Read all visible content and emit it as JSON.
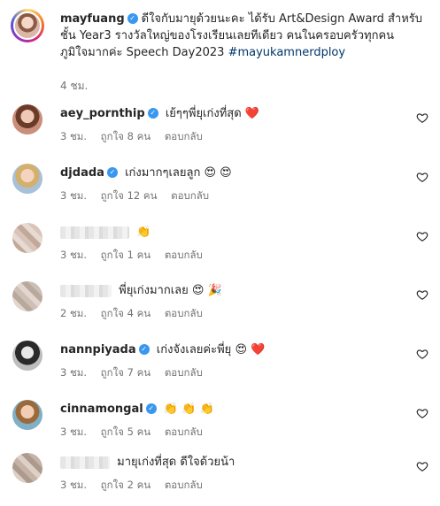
{
  "caption": {
    "username": "mayfuang",
    "text_line1": "ดีใจกับมายุด้วยนะคะ ได้รับ Art&Design Award สำหรับ",
    "text_line2": "ชั้น Year3 รางวัลใหญ่ของโรงเรียนเลยทีเดียว คนในครอบครัวทุกคน",
    "text_line3": "ภูมิใจมากค่ะ Speech Day2023",
    "hashtag": "#mayukamnerdploy",
    "time": "4 ชม."
  },
  "labels": {
    "likes_prefix": "ถูกใจ",
    "likes_suffix": "คน",
    "reply": "ตอบกลับ"
  },
  "comments": [
    {
      "username": "aey_pornthip",
      "verified": true,
      "text": "เย้ๆๆพี่ยุเก่งที่สุด",
      "emoji": "❤️",
      "time": "3 ชม.",
      "likes": "8"
    },
    {
      "username": "djdada",
      "verified": true,
      "text": "เก่งมากๆเลยลูก",
      "emoji": "😍 😍",
      "time": "3 ชม.",
      "likes": "12"
    },
    {
      "username": "",
      "verified": false,
      "text": "",
      "emoji": "👏",
      "time": "3 ชม.",
      "likes": "1"
    },
    {
      "username": "",
      "verified": false,
      "text": "พี่ยุเก่งมากเลย",
      "emoji": "😍 🎉",
      "time": "2 ชม.",
      "likes": "4"
    },
    {
      "username": "nannpiyada",
      "verified": true,
      "text": "เก่งจังเลยค่ะพี่ยุ",
      "emoji": "😍 ❤️",
      "time": "3 ชม.",
      "likes": "7"
    },
    {
      "username": "cinnamongal",
      "verified": true,
      "text": "",
      "emoji": "👏 👏 👏",
      "time": "3 ชม.",
      "likes": "5"
    },
    {
      "username": "",
      "verified": false,
      "text": "มายุเก่งที่สุด ดีใจด้วยน้า",
      "emoji": "",
      "time": "3 ชม.",
      "likes": "2"
    }
  ]
}
